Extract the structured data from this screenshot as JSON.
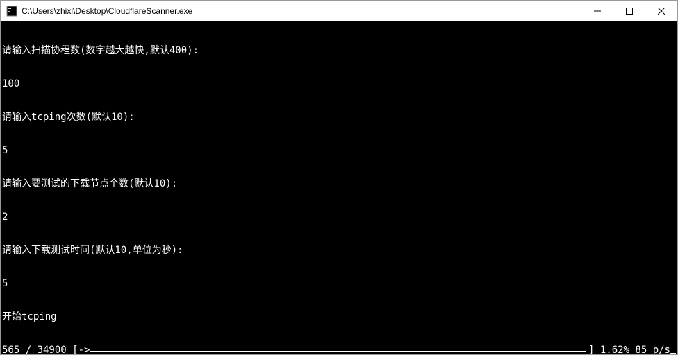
{
  "window": {
    "title": "C:\\Users\\zhixi\\Desktop\\CloudflareScanner.exe"
  },
  "console": {
    "lines": {
      "prompt_threads": "请输入扫描协程数(数字越大越快,默认400):",
      "input_threads": "100",
      "prompt_tcping": "请输入tcping次数(默认10):",
      "input_tcping": "5",
      "prompt_nodes": "请输入要测试的下载节点个数(默认10):",
      "input_nodes": "2",
      "prompt_downtime": "请输入下载测试时间(默认10,单位为秒):",
      "input_downtime": "5",
      "start": "开始tcping",
      "progress_prefix": "565 / 34900 [->",
      "progress_suffix": "] 1.62% 85 p/s"
    }
  }
}
